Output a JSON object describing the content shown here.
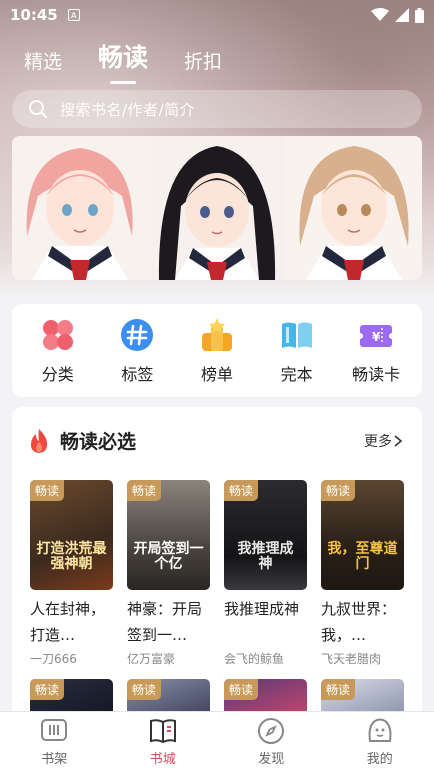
{
  "status": {
    "time": "10:45",
    "notif_letter": "A"
  },
  "top_tabs": [
    {
      "label": "精选"
    },
    {
      "label": "畅读"
    },
    {
      "label": "折扣"
    }
  ],
  "search": {
    "placeholder": "搜索书名/作者/简介"
  },
  "quick_actions": [
    {
      "label": "分类",
      "icon": "category-icon"
    },
    {
      "label": "标签",
      "icon": "hashtag-icon"
    },
    {
      "label": "榜单",
      "icon": "ranking-icon"
    },
    {
      "label": "完本",
      "icon": "book-icon"
    },
    {
      "label": "畅读卡",
      "icon": "ticket-icon"
    }
  ],
  "section": {
    "title": "畅读必选",
    "more": "更多",
    "books": [
      {
        "tag": "畅读",
        "title": "人在封神，打造…",
        "author": "一刀666",
        "cover_text": "打造洪荒最强神朝",
        "cover_colors": [
          "#3b2a1e",
          "#7a3b1c"
        ]
      },
      {
        "tag": "畅读",
        "title": "神豪：开局签到一…",
        "author": "亿万富豪",
        "cover_text": "开局签到一个亿",
        "cover_colors": [
          "#6f6a64",
          "#2a2623"
        ]
      },
      {
        "tag": "畅读",
        "title": "我推理成神",
        "author": "会飞的鲸鱼",
        "cover_text": "我推理成神",
        "cover_colors": [
          "#1c1c1e",
          "#3a3a3e"
        ]
      },
      {
        "tag": "畅读",
        "title": "九叔世界：我，…",
        "author": "飞天老腊肉",
        "cover_text": "我，至尊道门",
        "cover_colors": [
          "#4b3a2a",
          "#1d1812"
        ]
      }
    ],
    "next_row": [
      {
        "tag": "畅读",
        "cover_colors": [
          "#2a2f3e",
          "#121522"
        ]
      },
      {
        "tag": "畅读",
        "cover_colors": [
          "#8a8fa8",
          "#3a3e5a"
        ]
      },
      {
        "tag": "畅读",
        "cover_colors": [
          "#5a3a7a",
          "#c8466a"
        ]
      },
      {
        "tag": "畅读",
        "cover_colors": [
          "#d8dce8",
          "#8890a8"
        ]
      }
    ]
  },
  "bottom_nav": [
    {
      "label": "书架"
    },
    {
      "label": "书城"
    },
    {
      "label": "发现"
    },
    {
      "label": "我的"
    }
  ],
  "colors": {
    "accent": "#e2495f",
    "tag": "#c89a5a"
  }
}
